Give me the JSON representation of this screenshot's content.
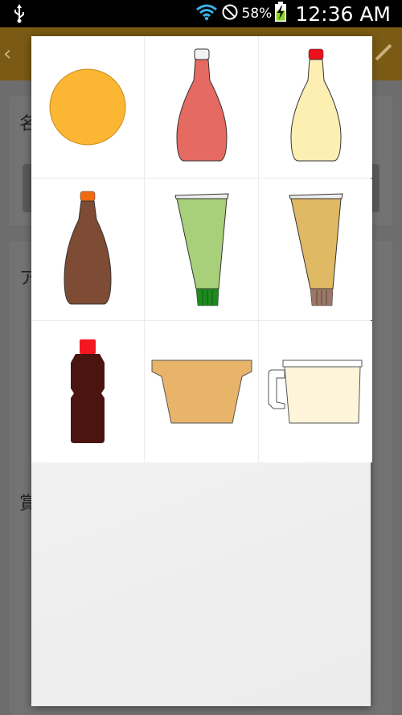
{
  "status_bar": {
    "battery_percent": "58%",
    "time": "12:36 AM",
    "icons": [
      "usb-icon",
      "wifi-icon",
      "do-not-disturb-icon",
      "battery-charging-icon"
    ]
  },
  "background": {
    "accent_color": "#7a5a14",
    "label_1": "名",
    "label_2": "ア",
    "label_3": "賞"
  },
  "picker": {
    "items": [
      {
        "name": "orange-circle",
        "color": "#fbb734"
      },
      {
        "name": "ketchup-bottle",
        "color": "#e56a62"
      },
      {
        "name": "mayonnaise-bottle",
        "color": "#fdeeb2"
      },
      {
        "name": "sauce-bottle",
        "color": "#7e4b34"
      },
      {
        "name": "wasabi-tube",
        "color": "#a8d07a"
      },
      {
        "name": "mustard-tube",
        "color": "#e0b964"
      },
      {
        "name": "soy-sauce-bottle",
        "color": "#4a1510"
      },
      {
        "name": "bowl",
        "color": "#e8b46a"
      },
      {
        "name": "measuring-cup",
        "color": "#fdf4d9"
      }
    ]
  }
}
